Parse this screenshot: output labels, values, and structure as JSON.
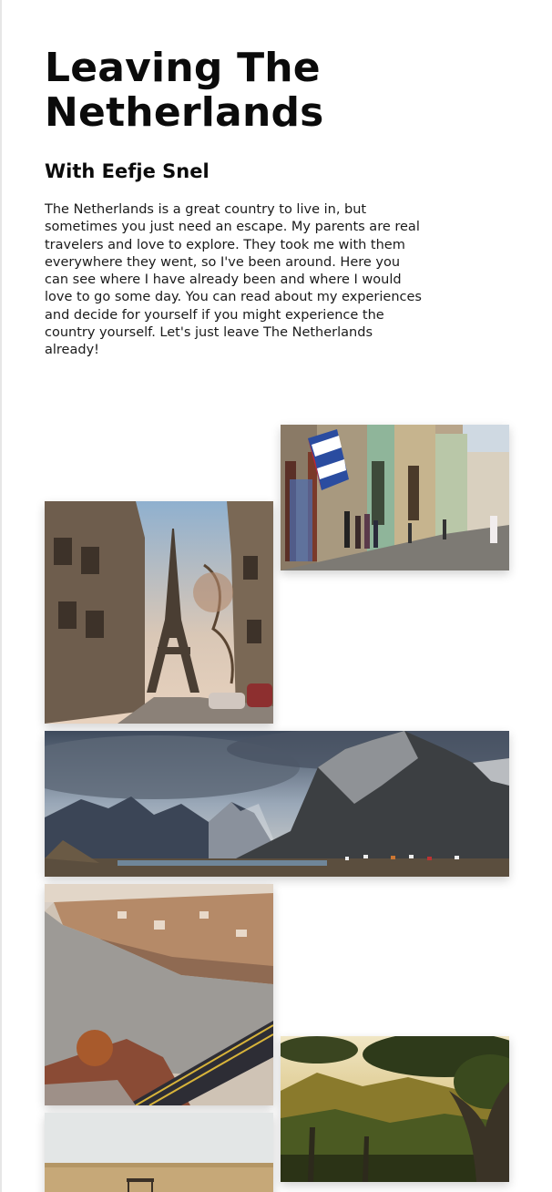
{
  "header": {
    "title": "Leaving The Netherlands",
    "subtitle": "With Eefje Snel"
  },
  "intro": {
    "text": "The Netherlands is a great country to live in, but sometimes you just need an escape. My parents are real travelers and love to explore. They took me with them everywhere they went, so I've been around. Here you can see where I have already been and where I would love to go some day. You can read about my experiences and decide for yourself if you might experience the country yourself. Let's just leave The Netherlands already!"
  }
}
